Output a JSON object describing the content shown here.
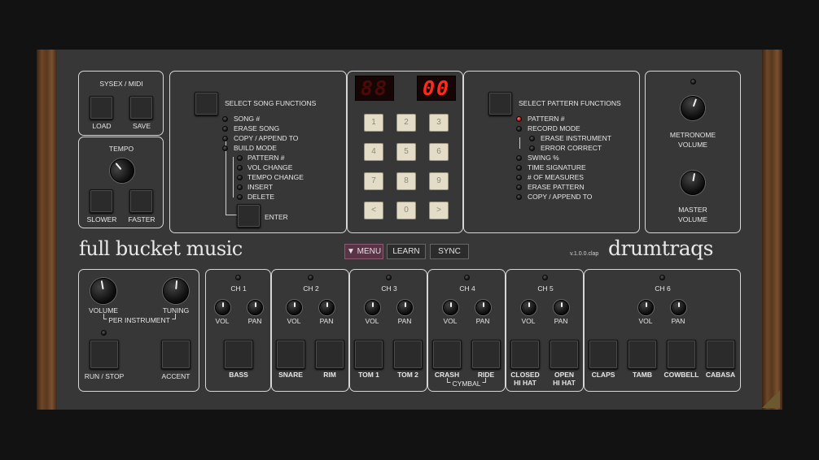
{
  "sysex": {
    "title": "SYSEX / MIDI",
    "load": "LOAD",
    "save": "SAVE"
  },
  "tempo": {
    "title": "TEMPO",
    "slower": "SLOWER",
    "faster": "FASTER"
  },
  "song": {
    "title": "SELECT SONG FUNCTIONS",
    "items": [
      "SONG #",
      "ERASE SONG",
      "COPY / APPEND TO",
      "BUILD MODE"
    ],
    "build_items": [
      "PATTERN #",
      "VOL CHANGE",
      "TEMPO CHANGE",
      "INSERT",
      "DELETE"
    ],
    "enter": "ENTER"
  },
  "display": {
    "left": "88",
    "right": "00"
  },
  "keypad": [
    "1",
    "2",
    "3",
    "4",
    "5",
    "6",
    "7",
    "8",
    "9",
    "<",
    "0",
    ">"
  ],
  "pattern": {
    "title": "SELECT PATTERN FUNCTIONS",
    "items": [
      "PATTERN #",
      "RECORD MODE"
    ],
    "record_items": [
      "ERASE INSTRUMENT",
      "ERROR CORRECT"
    ],
    "items2": [
      "SWING %",
      "TIME SIGNATURE",
      "# OF MEASURES",
      "ERASE PATTERN",
      "COPY / APPEND TO"
    ]
  },
  "volumes": {
    "metronome": "METRONOME",
    "master": "MASTER",
    "volume": "VOLUME"
  },
  "brand": {
    "left": "full bucket music",
    "version": "v.1.0.0.clap",
    "right": "drumtraqs"
  },
  "toolbar": {
    "menu": "▼ MENU",
    "learn": "LEARN",
    "sync": "SYNC"
  },
  "global": {
    "volume": "VOLUME",
    "tuning": "TUNING",
    "per_instrument": "PER INSTRUMENT",
    "run_stop": "RUN / STOP",
    "accent": "ACCENT"
  },
  "channels": {
    "vol": "VOL",
    "pan": "PAN",
    "ch": [
      "CH 1",
      "CH 2",
      "CH 3",
      "CH 4",
      "CH 5",
      "CH 6"
    ],
    "pads": [
      "BASS",
      "SNARE",
      "RIM",
      "TOM 1",
      "TOM 2",
      "CRASH",
      "RIDE",
      "CLOSED",
      "OPEN",
      "CLAPS",
      "TAMB",
      "COWBELL",
      "CABASA"
    ],
    "pads_line2": [
      "HI HAT",
      "HI HAT"
    ],
    "cymbal": "CYMBAL"
  },
  "colors": {
    "panel": "#373737",
    "outline": "#d6d6d6",
    "led_on": "#c01010",
    "display": "#ff2a1a",
    "key": "#e3dcc6",
    "menu_accent": "#5a3346"
  }
}
